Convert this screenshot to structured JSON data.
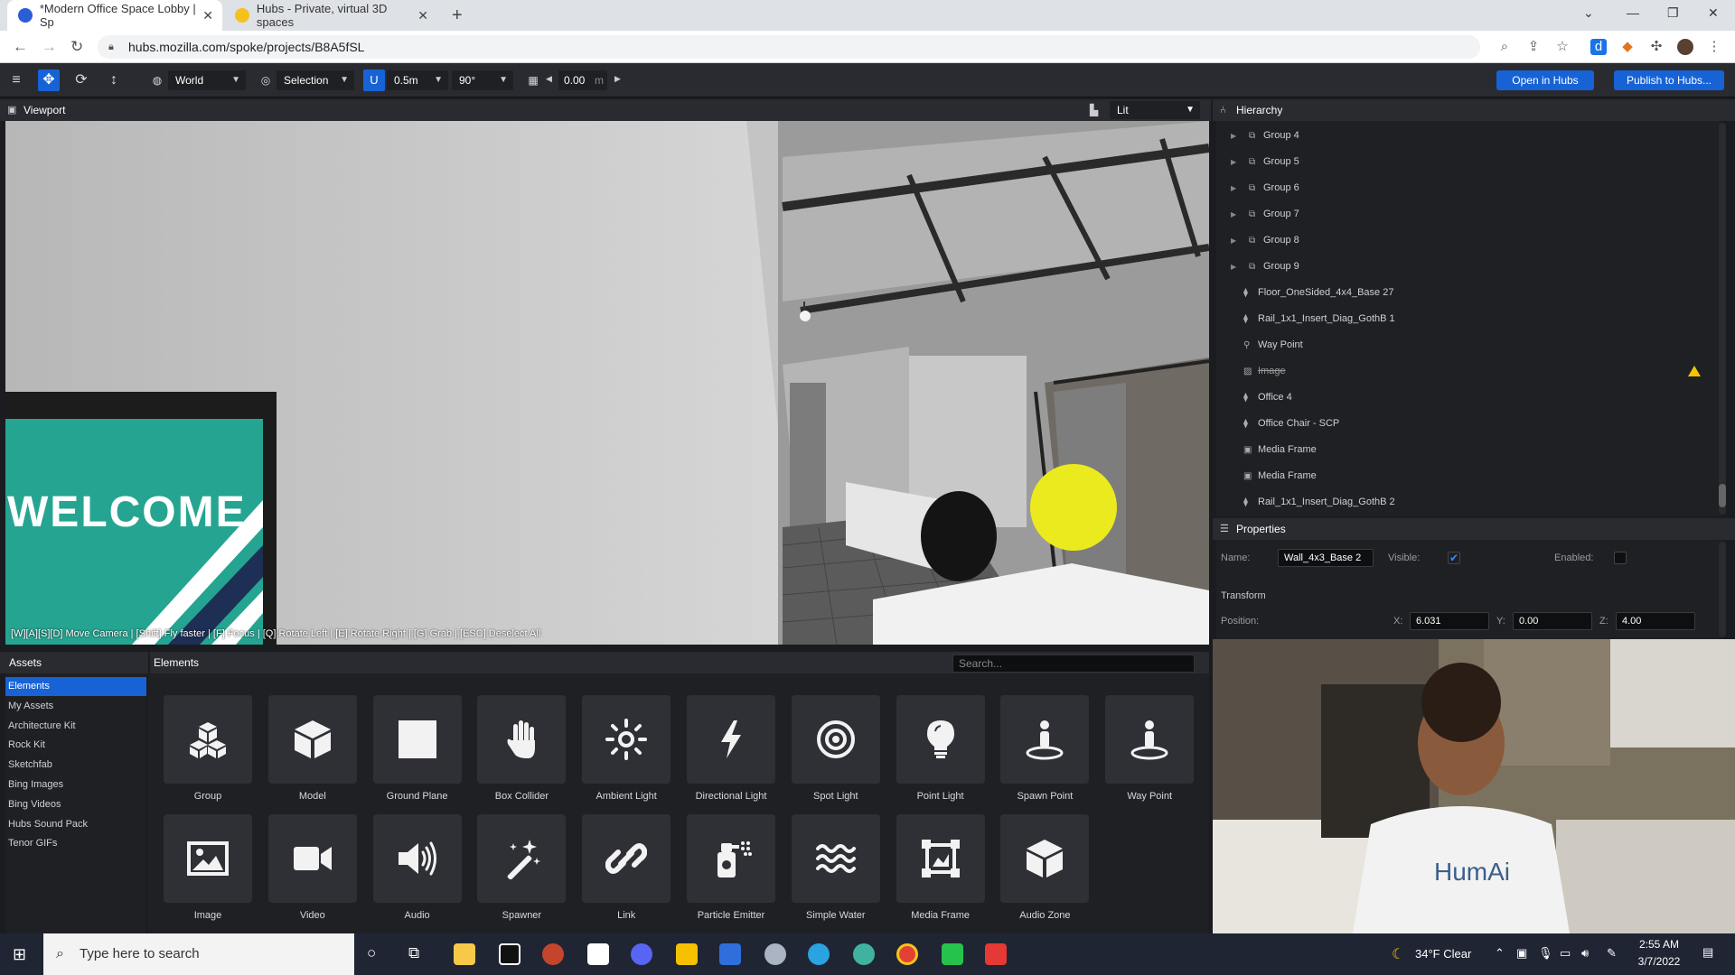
{
  "browser": {
    "tabs": [
      {
        "title": "*Modern Office Space Lobby | Sp",
        "active": true
      },
      {
        "title": "Hubs - Private, virtual 3D spaces",
        "active": false
      }
    ],
    "new_tab": "+",
    "url": "hubs.mozilla.com/spoke/projects/B8A5fSL"
  },
  "toolbar": {
    "space": "World",
    "mode": "Selection",
    "snap": "0.5m",
    "angle": "90°",
    "grid_value": "0.00",
    "grid_unit": "m",
    "open_in_hubs": "Open in Hubs",
    "publish": "Publish to Hubs..."
  },
  "viewport": {
    "title": "Viewport",
    "render_mode": "Lit",
    "welcome_text": "WELCOME",
    "help_text": "[W][A][S][D] Move Camera | [Shift] Fly faster | [F] Focus | [Q] Rotate Left | [E] Rotate Right | [G] Grab | [ESC] Deselect All"
  },
  "hierarchy": {
    "title": "Hierarchy",
    "items": [
      {
        "label": "Group 4",
        "type": "group",
        "expandable": true
      },
      {
        "label": "Group 5",
        "type": "group",
        "expandable": true
      },
      {
        "label": "Group 6",
        "type": "group",
        "expandable": true
      },
      {
        "label": "Group 7",
        "type": "group",
        "expandable": true
      },
      {
        "label": "Group 8",
        "type": "group",
        "expandable": true
      },
      {
        "label": "Group 9",
        "type": "group",
        "expandable": true
      },
      {
        "label": "Floor_OneSided_4x4_Base 27",
        "type": "model"
      },
      {
        "label": "Rail_1x1_Insert_Diag_GothB 1",
        "type": "model"
      },
      {
        "label": "Way Point",
        "type": "waypoint"
      },
      {
        "label": "Image",
        "type": "image",
        "strike": true,
        "warning": true
      },
      {
        "label": "Office 4",
        "type": "model"
      },
      {
        "label": "Office Chair - SCP",
        "type": "model"
      },
      {
        "label": "Media Frame",
        "type": "frame"
      },
      {
        "label": "Media Frame",
        "type": "frame"
      },
      {
        "label": "Rail_1x1_Insert_Diag_GothB 2",
        "type": "model"
      }
    ]
  },
  "properties": {
    "title": "Properties",
    "name_label": "Name:",
    "name_value": "Wall_4x3_Base 2",
    "visible_label": "Visible:",
    "enabled_label": "Enabled:",
    "transform_label": "Transform",
    "position_label": "Position:",
    "x_label": "X:",
    "x": "6.031",
    "y_label": "Y:",
    "y": "0.00",
    "z_label": "Z:",
    "z": "4.00"
  },
  "assets": {
    "title": "Assets",
    "items": [
      "Elements",
      "My Assets",
      "Architecture Kit",
      "Rock Kit",
      "Sketchfab",
      "Bing Images",
      "Bing Videos",
      "Hubs Sound Pack",
      "Tenor GIFs"
    ],
    "selected": 0
  },
  "elements": {
    "title": "Elements",
    "search_placeholder": "Search...",
    "tiles": [
      {
        "label": "Group",
        "icon": "group-icon"
      },
      {
        "label": "Model",
        "icon": "cube-icon"
      },
      {
        "label": "Ground Plane",
        "icon": "square-icon"
      },
      {
        "label": "Box Collider",
        "icon": "hand-icon"
      },
      {
        "label": "Ambient Light",
        "icon": "sun-icon"
      },
      {
        "label": "Directional Light",
        "icon": "bolt-icon"
      },
      {
        "label": "Spot Light",
        "icon": "target-icon"
      },
      {
        "label": "Point Light",
        "icon": "bulb-icon"
      },
      {
        "label": "Spawn Point",
        "icon": "person-icon"
      },
      {
        "label": "Way Point",
        "icon": "person-icon"
      },
      {
        "label": "Image",
        "icon": "image-icon"
      },
      {
        "label": "Video",
        "icon": "video-icon"
      },
      {
        "label": "Audio",
        "icon": "speaker-icon"
      },
      {
        "label": "Spawner",
        "icon": "wand-icon"
      },
      {
        "label": "Link",
        "icon": "link-icon"
      },
      {
        "label": "Particle Emitter",
        "icon": "spray-icon"
      },
      {
        "label": "Simple Water",
        "icon": "water-icon"
      },
      {
        "label": "Media Frame",
        "icon": "frame-icon"
      },
      {
        "label": "Audio Zone",
        "icon": "cube-icon"
      }
    ]
  },
  "webcam": {
    "shirt_text": "HumAi"
  },
  "taskbar": {
    "search_placeholder": "Type here to search",
    "weather": "34°F  Clear",
    "time": "2:55 AM",
    "date": "3/7/2022"
  }
}
